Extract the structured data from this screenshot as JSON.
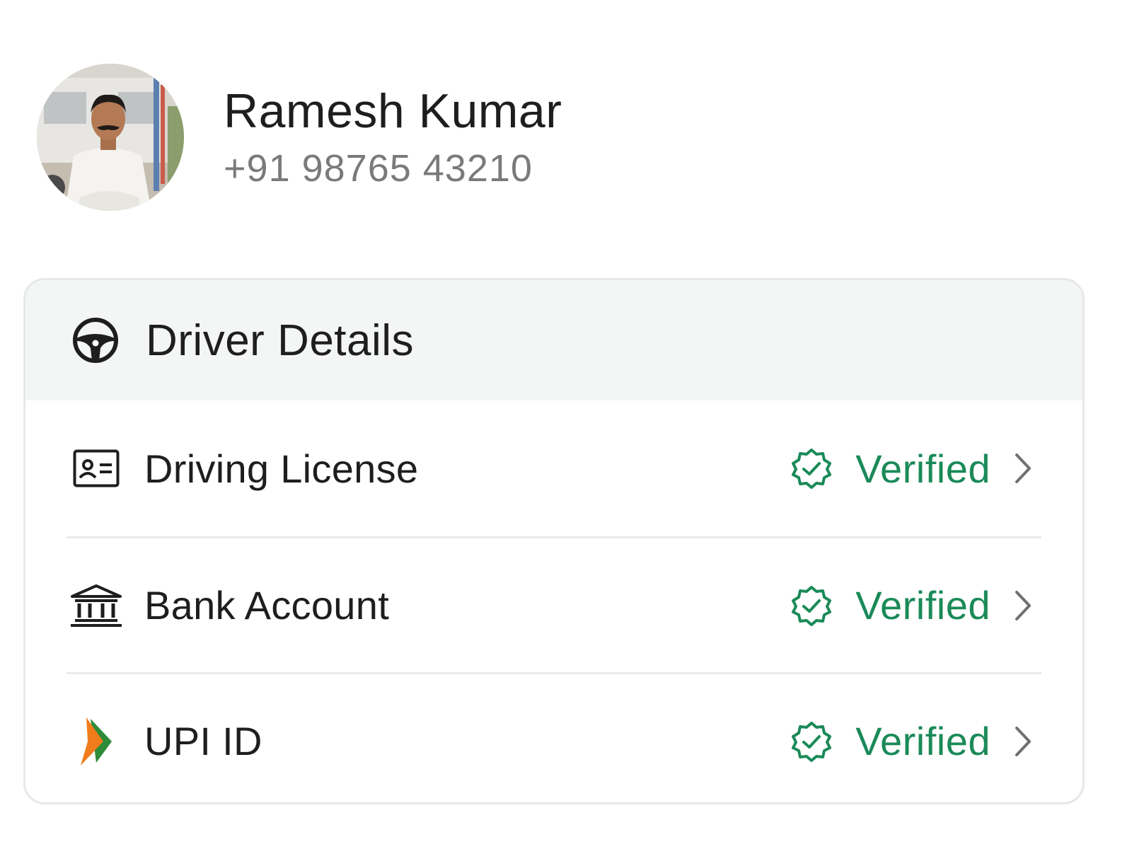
{
  "profile": {
    "name": "Ramesh Kumar",
    "phone": "+91 98765 43210",
    "avatar_icon": "driver-photo"
  },
  "card": {
    "title": "Driver Details",
    "header_icon": "steering-wheel-icon",
    "items": [
      {
        "label": "Driving License",
        "icon": "id-card-icon",
        "status": "Verified"
      },
      {
        "label": "Bank Account",
        "icon": "bank-icon",
        "status": "Verified"
      },
      {
        "label": "UPI ID",
        "icon": "upi-logo-icon",
        "status": "Verified"
      }
    ]
  },
  "colors": {
    "verified": "#1a8a58",
    "header_bg": "#f4f5f5",
    "text": "#1e1e1e",
    "muted": "#7a7a7a"
  }
}
